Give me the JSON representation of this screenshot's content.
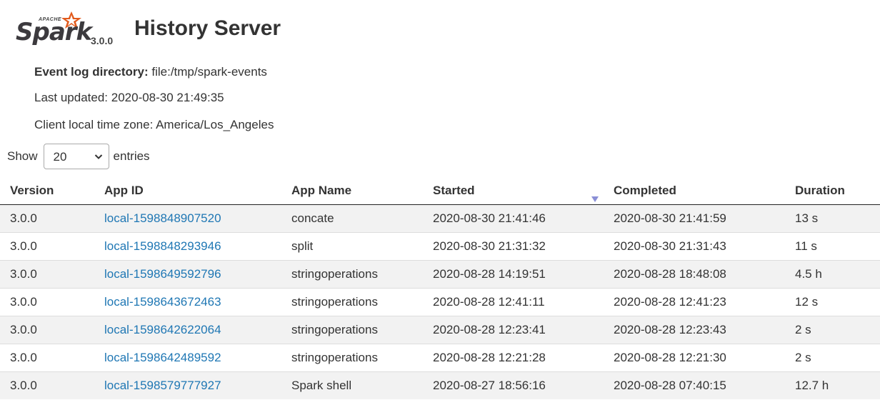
{
  "header": {
    "logo_top": "APACHE",
    "logo_text": "Spark",
    "version": "3.0.0",
    "title": "History Server",
    "accent_color": "#e25a1c"
  },
  "info": {
    "event_log_label": "Event log directory:",
    "event_log_value": "file:/tmp/spark-events",
    "last_updated": "Last updated: 2020-08-30 21:49:35",
    "timezone": "Client local time zone: America/Los_Angeles"
  },
  "entries": {
    "show_label": "Show",
    "selected": "20",
    "suffix": "entries"
  },
  "table": {
    "headers": [
      "Version",
      "App ID",
      "App Name",
      "Started",
      "Completed",
      "Duration"
    ],
    "sorted_column": "Started",
    "sort_direction": "descending",
    "rows": [
      {
        "version": "3.0.0",
        "app_id": "local-1598848907520",
        "app_name": "concate",
        "started": "2020-08-30 21:41:46",
        "completed": "2020-08-30 21:41:59",
        "duration": "13 s"
      },
      {
        "version": "3.0.0",
        "app_id": "local-1598848293946",
        "app_name": "split",
        "started": "2020-08-30 21:31:32",
        "completed": "2020-08-30 21:31:43",
        "duration": "11 s"
      },
      {
        "version": "3.0.0",
        "app_id": "local-1598649592796",
        "app_name": "stringoperations",
        "started": "2020-08-28 14:19:51",
        "completed": "2020-08-28 18:48:08",
        "duration": "4.5 h"
      },
      {
        "version": "3.0.0",
        "app_id": "local-1598643672463",
        "app_name": "stringoperations",
        "started": "2020-08-28 12:41:11",
        "completed": "2020-08-28 12:41:23",
        "duration": "12 s"
      },
      {
        "version": "3.0.0",
        "app_id": "local-1598642622064",
        "app_name": "stringoperations",
        "started": "2020-08-28 12:23:41",
        "completed": "2020-08-28 12:23:43",
        "duration": "2 s"
      },
      {
        "version": "3.0.0",
        "app_id": "local-1598642489592",
        "app_name": "stringoperations",
        "started": "2020-08-28 12:21:28",
        "completed": "2020-08-28 12:21:30",
        "duration": "2 s"
      },
      {
        "version": "3.0.0",
        "app_id": "local-1598579777927",
        "app_name": "Spark shell",
        "started": "2020-08-27 18:56:16",
        "completed": "2020-08-28 07:40:15",
        "duration": "12.7 h"
      }
    ]
  }
}
